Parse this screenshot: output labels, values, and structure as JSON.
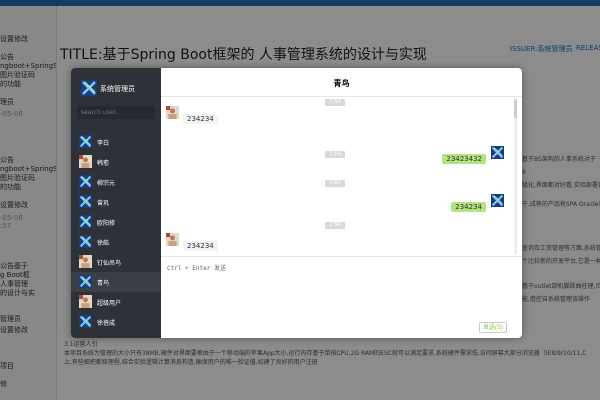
{
  "page": {
    "title": "TITLE:基于Spring Boot框架的 人事管理系统的设计与实现",
    "issuer": "ISSUER:系统管理员",
    "release": "RELEAS",
    "left_items": [
      "设置修改",
      "公告",
      "ngboot+SpringS",
      "图片验证码",
      "的功能",
      "理员",
      "-05-08",
      "公告",
      "ngboot+SpringS",
      "图片验证码",
      "的功能",
      "设置修改",
      "-05-08",
      ":57",
      "公告基于",
      "g Boot框",
      "人事管理",
      "的设计与实",
      "管理员",
      "设置修改",
      "项目",
      "修"
    ],
    "right_lines": [
      "基于BS架构的人事系统对于",
      "6",
      "级化,界面都对好看,实验部署容",
      "于,成熟的产品有SPA Oracle和",
      "查询及工资管理等方面,系统管",
      "个比较新的开发平台,它是一种",
      "基于outlet部机脚踩曲柱理,页面",
      "能,借控自系统管理该操作"
    ],
    "bottom_lines": [
      "3.1运营人引",
      "本项目系统为管理的大小只有38MB,硬件对界面要根由于一个移动端的苹果App大小,运行内存基于单核CPU,2G RAM的ESC就可以满足要求,系统硬件需求低,访问屏幕大部分浏览器（IE8/9/10/11,C",
      "上,有些细把都择理程,结合实验逻辑计算消息构造,确保用户的唯一验证值,如建了良好的用户注册"
    ]
  },
  "modal": {
    "current_user": {
      "name": "系统管理员",
      "avatar_icon": "blue-x-avatar"
    },
    "search_placeholder": "search user...",
    "contacts": [
      {
        "name": "李白",
        "icon": "blue-x-avatar",
        "active": false
      },
      {
        "name": "韩愈",
        "icon": "photo-avatar",
        "active": false
      },
      {
        "name": "柳宗元",
        "icon": "blue-x-avatar",
        "active": false
      },
      {
        "name": "曾巩",
        "icon": "blue-x-avatar",
        "active": false
      },
      {
        "name": "欧阳修",
        "icon": "blue-x-avatar",
        "active": false
      },
      {
        "name": "徐皓",
        "icon": "blue-x-avatar",
        "active": false
      },
      {
        "name": "钉仙吊鸟",
        "icon": "photo-avatar",
        "active": false
      },
      {
        "name": "青鸟",
        "icon": "blue-x-avatar",
        "active": true
      },
      {
        "name": "超级用户",
        "icon": "photo-avatar",
        "active": false
      },
      {
        "name": "徐蓓成",
        "icon": "blue-x-avatar",
        "active": false
      }
    ],
    "chat_title": "青鸟",
    "messages": [
      {
        "time": "1:54",
        "side": "left",
        "text": "234234",
        "avatar": "photo-avatar"
      },
      {
        "time": "1:54",
        "side": "right",
        "text": "23423432",
        "avatar": "blue-x-avatar"
      },
      {
        "time": "1:54",
        "side": "right",
        "text": "234234",
        "avatar": "blue-x-avatar"
      },
      {
        "time": "1:54",
        "side": "left",
        "text": "234234",
        "avatar": "photo-avatar"
      }
    ],
    "input_hint": "Ctrl + Enter 发送",
    "send_label": "发送(S)"
  },
  "colors": {
    "topbar": "#1f6fb5",
    "sidebar": "#2e3238",
    "bubble_right": "#b2e281",
    "bubble_left": "#f3f3f3",
    "send_text": "#7ac143"
  }
}
